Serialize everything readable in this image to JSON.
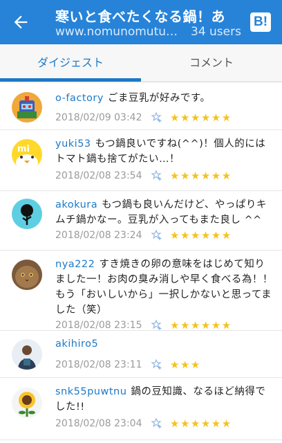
{
  "header": {
    "title": "寒いと食べたくなる鍋！あ",
    "url": "www.nomunomutuk...",
    "users": "34 users",
    "hatena_label": "B!"
  },
  "tabs": [
    {
      "label": "ダイジェスト",
      "active": true
    },
    {
      "label": "コメント",
      "active": false
    }
  ],
  "comments": [
    {
      "user": "o-factory",
      "text": "ごま豆乳が好みです。",
      "date": "2018/02/09 03:42",
      "stars": 6,
      "star_text": "★★★★★★",
      "avatar": "robot-avatar"
    },
    {
      "user": "yuki53",
      "text": "もつ鍋良いですね(^^)！個人的にはトマト鍋も捨てがたい…！",
      "date": "2018/02/08 23:54",
      "stars": 6,
      "star_text": "★★★★★★",
      "avatar": "chick-avatar"
    },
    {
      "user": "akokura",
      "text": "もつ鍋も良いんだけど、やっぱりキムチ鍋かなー。豆乳が入ってもまた良し ^^",
      "date": "2018/02/08 23:24",
      "stars": 6,
      "star_text": "★★★★★★",
      "avatar": "rose-avatar"
    },
    {
      "user": "nya222",
      "text": "すき焼きの卵の意味をはじめて知りました一！お肉の臭み消しや早く食べる為！！もう「おいしいから」一択しかないと思ってました（笑）",
      "date": "2018/02/08 23:15",
      "stars": 6,
      "star_text": "★★★★★★",
      "avatar": "cat-avatar"
    },
    {
      "user": "akihiro5",
      "text": "",
      "date": "2018/02/08 23:11",
      "stars": 3,
      "star_text": "★★★",
      "avatar": "person-avatar"
    },
    {
      "user": "snk55puwtnu",
      "text": "鍋の豆知識、なるほど納得でした!!",
      "date": "2018/02/08 23:04",
      "stars": 6,
      "star_text": "★★★★★★",
      "avatar": "sunflower-avatar"
    }
  ],
  "colors": {
    "accent": "#2683d8",
    "link": "#1c79c7",
    "star": "#f4c21e",
    "date": "#9a9a9a"
  }
}
